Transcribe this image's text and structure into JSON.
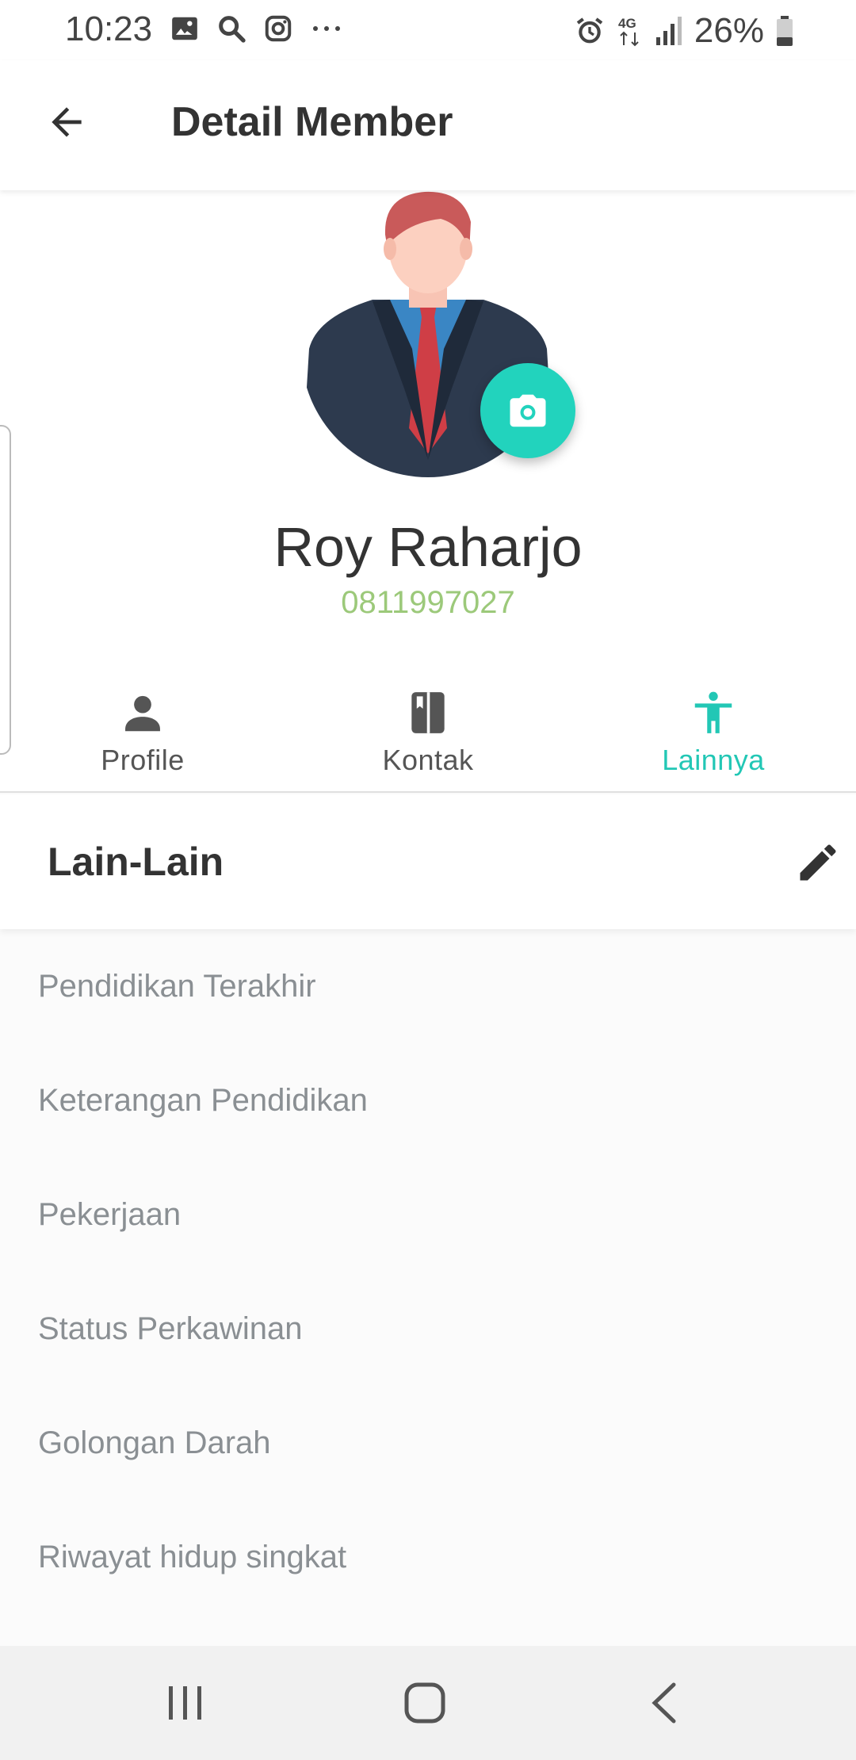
{
  "status_bar": {
    "time": "10:23",
    "battery": "26%",
    "left_icons": [
      "image-icon",
      "search-icon",
      "instagram-icon",
      "more-icon"
    ],
    "right_icons": [
      "alarm-icon",
      "4g-icon",
      "signal-icon",
      "battery-icon"
    ]
  },
  "app_bar": {
    "title": "Detail Member",
    "back_icon": "arrow-back-icon"
  },
  "profile": {
    "name": "Roy Raharjo",
    "phone": "0811997027",
    "camera_icon": "camera-icon"
  },
  "tabs": [
    {
      "label": "Profile",
      "icon": "person-icon",
      "active": false
    },
    {
      "label": "Kontak",
      "icon": "contact-book-icon",
      "active": false
    },
    {
      "label": "Lainnya",
      "icon": "accessibility-icon",
      "active": true
    }
  ],
  "section": {
    "title": "Lain-Lain",
    "edit_icon": "pencil-icon"
  },
  "fields": [
    "Pendidikan Terakhir",
    "Keterangan Pendidikan",
    "Pekerjaan",
    "Status Perkawinan",
    "Golongan Darah",
    "Riwayat hidup singkat"
  ],
  "colors": {
    "accent": "#22d3bd",
    "active_tab": "#22c7b5",
    "phone": "#9cc97a"
  }
}
